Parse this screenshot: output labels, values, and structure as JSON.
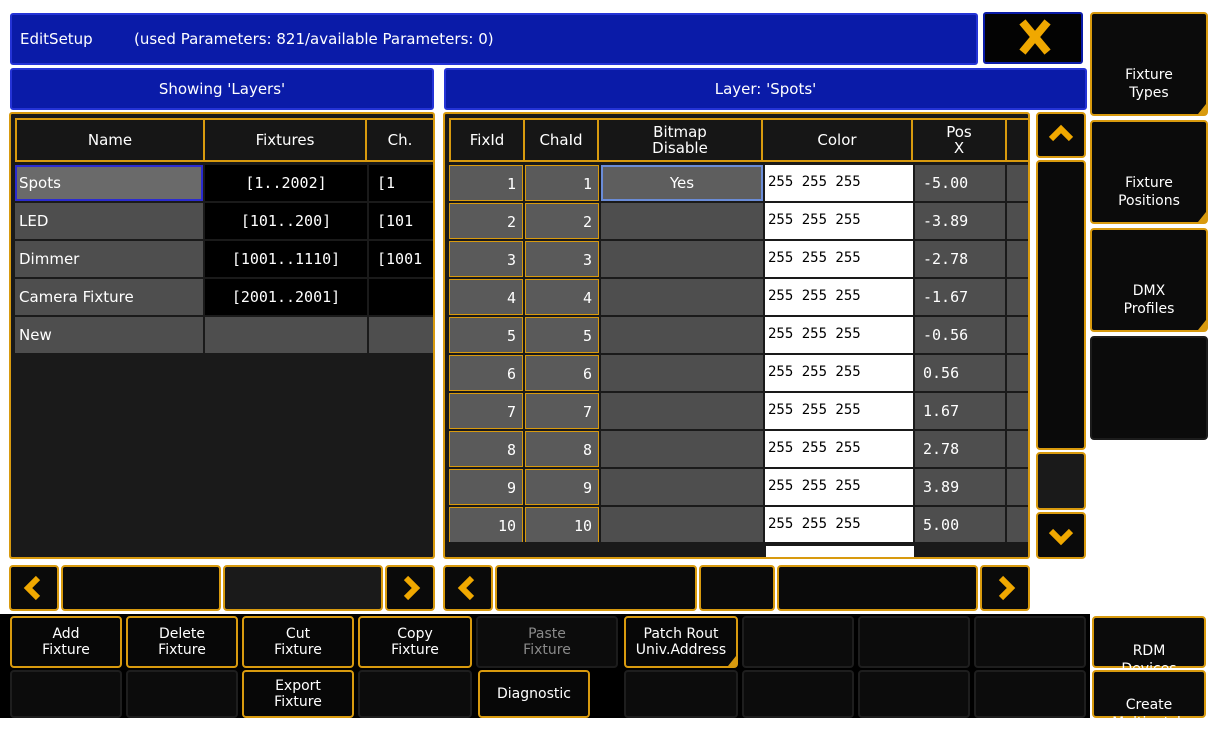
{
  "title_bar": {
    "app": "EditSetup",
    "info": "(used Parameters: 821/available Parameters: 0)",
    "close_glyph": "✕"
  },
  "left_panel": {
    "header": "Showing 'Layers'",
    "columns": [
      "Name",
      "Fixtures",
      "Ch."
    ],
    "rows": [
      {
        "name": "Spots",
        "fixtures": "[1..2002]",
        "ch": "[1"
      },
      {
        "name": "LED",
        "fixtures": "[101..200]",
        "ch": "[101"
      },
      {
        "name": "Dimmer",
        "fixtures": "[1001..1110]",
        "ch": "[1001"
      },
      {
        "name": "Camera Fixture",
        "fixtures": "[2001..2001]",
        "ch": ""
      },
      {
        "name": "New",
        "fixtures": "",
        "ch": ""
      }
    ]
  },
  "right_panel": {
    "header": "Layer: 'Spots'",
    "columns": [
      "FixId",
      "ChaId",
      "Bitmap Disable",
      "Color",
      "Pos X"
    ],
    "rows": [
      {
        "fixid": "1",
        "chaid": "1",
        "bitmap": "Yes",
        "color": "255 255 255",
        "posx": "-5.00"
      },
      {
        "fixid": "2",
        "chaid": "2",
        "bitmap": "",
        "color": "255 255 255",
        "posx": "-3.89"
      },
      {
        "fixid": "3",
        "chaid": "3",
        "bitmap": "",
        "color": "255 255 255",
        "posx": "-2.78"
      },
      {
        "fixid": "4",
        "chaid": "4",
        "bitmap": "",
        "color": "255 255 255",
        "posx": "-1.67"
      },
      {
        "fixid": "5",
        "chaid": "5",
        "bitmap": "",
        "color": "255 255 255",
        "posx": "-0.56"
      },
      {
        "fixid": "6",
        "chaid": "6",
        "bitmap": "",
        "color": "255 255 255",
        "posx": "0.56"
      },
      {
        "fixid": "7",
        "chaid": "7",
        "bitmap": "",
        "color": "255 255 255",
        "posx": "1.67"
      },
      {
        "fixid": "8",
        "chaid": "8",
        "bitmap": "",
        "color": "255 255 255",
        "posx": "2.78"
      },
      {
        "fixid": "9",
        "chaid": "9",
        "bitmap": "",
        "color": "255 255 255",
        "posx": "3.89"
      },
      {
        "fixid": "10",
        "chaid": "10",
        "bitmap": "",
        "color": "255 255 255",
        "posx": "5.00"
      }
    ]
  },
  "side_buttons": {
    "fixture_types": "Fixture\nTypes",
    "fixture_positions": "Fixture\nPositions",
    "dmx_profiles": "DMX\nProfiles",
    "rdm_devices": "RDM\nDevices",
    "create_multipatch": "Create\nMultipatch"
  },
  "bottom_buttons": {
    "add_fixture": "Add\nFixture",
    "delete_fixture": "Delete\nFixture",
    "cut_fixture": "Cut\nFixture",
    "copy_fixture": "Copy\nFixture",
    "paste_fixture": "Paste\nFixture",
    "patch_rout": "Patch Rout\nUniv.Address",
    "export_fixture": "Export\nFixture",
    "diagnostic": "Diagnostic"
  },
  "icons": {
    "scroll_up": "chevron-up-icon",
    "scroll_down": "chevron-down-icon",
    "scroll_left": "chevron-left-icon",
    "scroll_right": "chevron-right-icon",
    "close": "close-icon"
  },
  "colors": {
    "accent": "#d89a0e",
    "title_blue": "#0a1ba8",
    "panel_bg": "#1a1a1a",
    "cell_grey": "#5a5a5a",
    "color_cell": "#ffffff"
  }
}
